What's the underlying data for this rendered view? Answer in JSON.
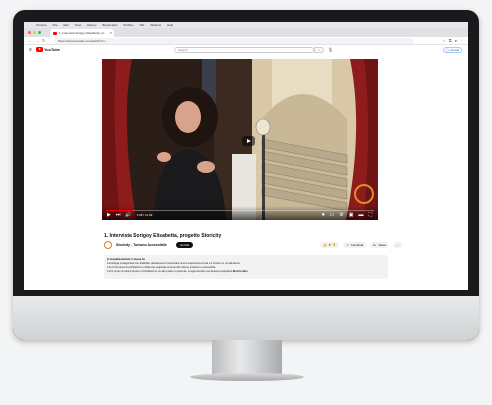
{
  "browser": {
    "menu": [
      "Chrome",
      "File",
      "Edit",
      "View",
      "History",
      "Bookmarks",
      "Profiles",
      "Tab",
      "Window",
      "Help"
    ],
    "tab_title": "1. Intervista Sorigoy Elisabetta, pr...",
    "url": "https://www.youtube.com/watch?v=...",
    "colors": {
      "close": "#ff5f57",
      "minimize": "#febc2e",
      "maximize": "#28c840"
    }
  },
  "youtube": {
    "logo_text": "YouTube",
    "search_placeholder": "Search",
    "signin_label": "Accedi"
  },
  "video": {
    "time": "1:08 / 11:39",
    "progress": 0.1,
    "title": "1. Intervista Sorigoy Elisabetta, progetto Storicity",
    "channel": "Storicity - Turismo Accessibile",
    "subscribe_label": "Iscriviti",
    "likes": "8",
    "share_label": "Condividi",
    "save_label": "Salva"
  },
  "description": {
    "meta": "9 visualizzazioni  1 mese fa",
    "lines": [
      "La biologa protagonista con disabilità, desiderosa di raccontare la loro esperienza di vita e il turismo in un abbraccio",
      "Con l'intervento di Architettura e della rete regionale al tema del turismo inclusivo e accessibile.",
      "Il loro punto di vista importa ci inchiodarsi in un altro piano e presente. Luoghi accolto una diversa prospettiva"
    ],
    "more_label": "Mostra altro"
  }
}
